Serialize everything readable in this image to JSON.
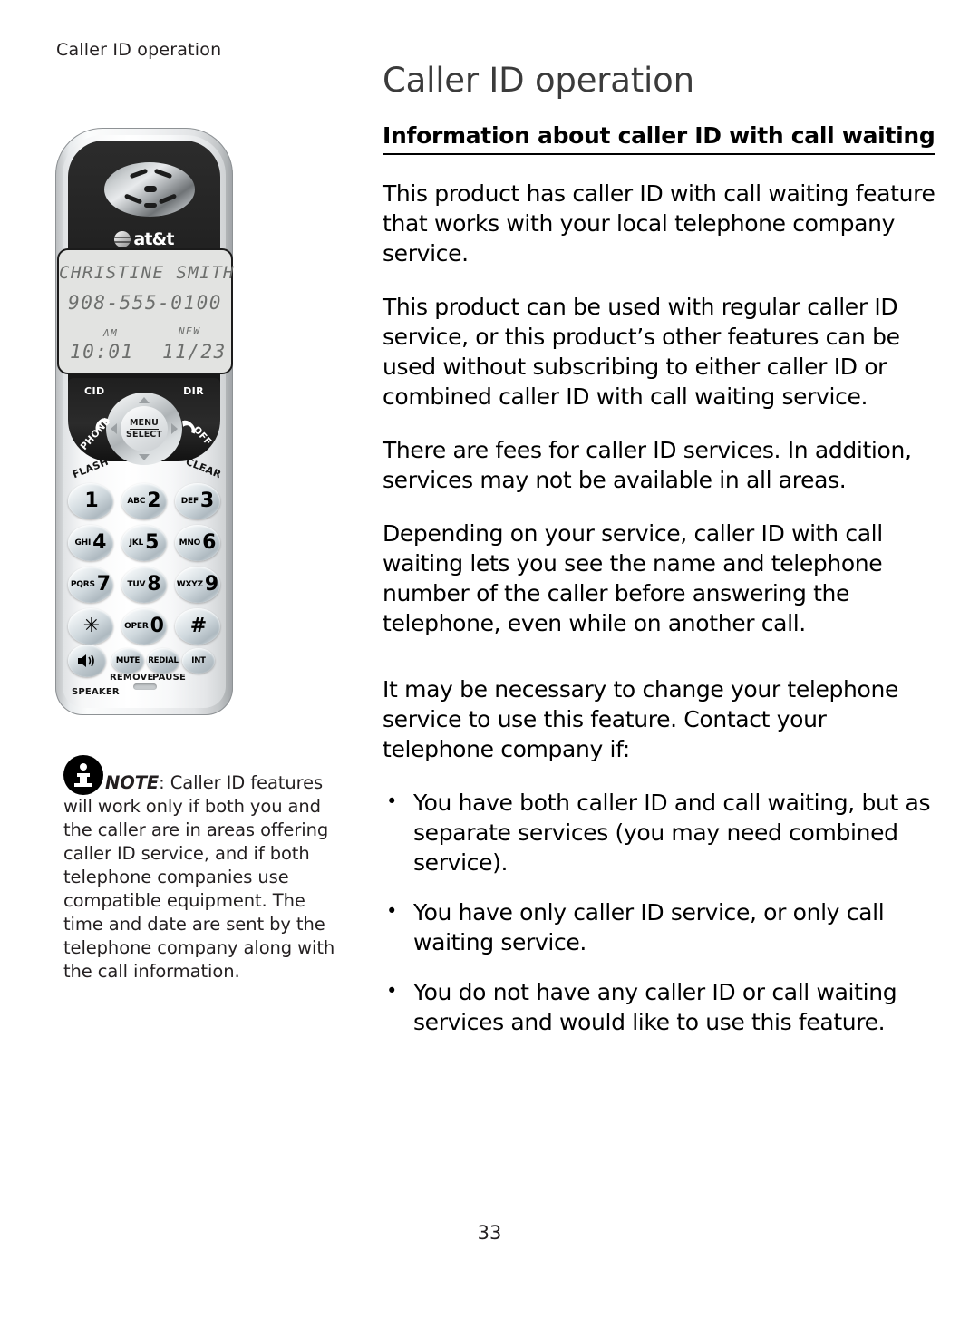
{
  "running_header": "Caller ID operation",
  "page_title": "Caller ID operation",
  "section_title": "Information about caller ID with call waiting",
  "page_number": "33",
  "paragraphs": [
    "This product has caller ID with call waiting feature that works with your local telephone company service.",
    "This product can be used with regular caller ID service, or this product’s other features can be used without subscribing to either caller ID or combined caller ID with call waiting service.",
    "There are fees for caller ID services. In addition, services may not be available in all areas.",
    "Depending on your service, caller ID with call waiting lets you see the name and telephone number of the caller before answering the telephone, even while on another call.",
    "It may be necessary to change your telephone service to use this feature. Contact your telephone company if:"
  ],
  "bullets": [
    "You have both caller ID and call waiting, but as separate services (you may need combined service).",
    "You have only caller ID service, or only call waiting service.",
    "You do not have any caller ID or call waiting services and would like to use this feature."
  ],
  "note": {
    "lead": "NOTE",
    "lead_sep": ":",
    "body": " Caller ID features will work only if both you and the caller are in areas offering caller ID service, and if both telephone companies use compatible equipment. The time and date are sent by the telephone company along with the call information."
  },
  "phone": {
    "brand": "at&t",
    "lcd": {
      "name": "CHRISTINE SMITH",
      "number": "908-555-0100",
      "ampm": "AM",
      "time": "10:01",
      "new_flag": "NEW",
      "date": "11/23"
    },
    "nav": {
      "cid": "CID",
      "dir": "DIR",
      "menu": "MENU",
      "select": "SELECT",
      "phone": "PHONE",
      "off": "OFF",
      "flash": "FLASH",
      "clear": "CLEAR"
    },
    "keys": [
      {
        "digit": "1",
        "letters": ""
      },
      {
        "digit": "2",
        "letters": "ABC"
      },
      {
        "digit": "3",
        "letters": "DEF"
      },
      {
        "digit": "4",
        "letters": "GHI"
      },
      {
        "digit": "5",
        "letters": "JKL"
      },
      {
        "digit": "6",
        "letters": "MNO"
      },
      {
        "digit": "7",
        "letters": "PQRS"
      },
      {
        "digit": "8",
        "letters": "TUV"
      },
      {
        "digit": "9",
        "letters": "WXYZ"
      },
      {
        "digit": "✳",
        "letters": ""
      },
      {
        "digit": "0",
        "letters": "OPER"
      },
      {
        "digit": "#",
        "letters": ""
      }
    ],
    "function_keys": {
      "mute": "MUTE",
      "redial": "REDIAL",
      "int": "INT",
      "remove": "REMOVE",
      "pause": "PAUSE",
      "speaker": "SPEAKER"
    }
  }
}
